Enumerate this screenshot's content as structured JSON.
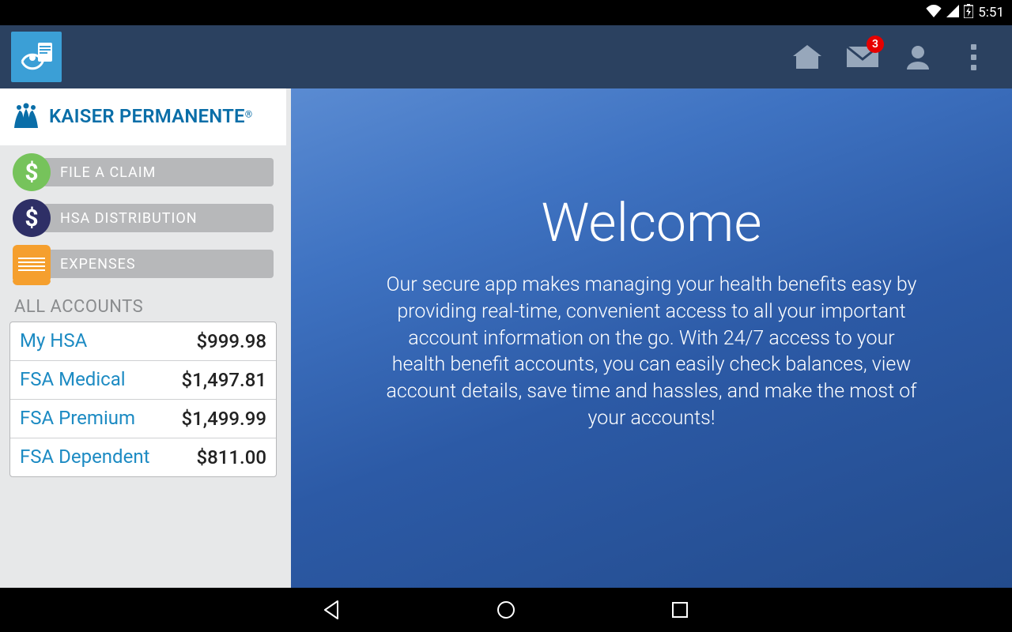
{
  "status": {
    "time": "5:51"
  },
  "appbar": {
    "badge": "3"
  },
  "brand": {
    "name": "KAISER PERMANENTE",
    "reg": "®"
  },
  "actions": {
    "file_claim": "FILE A CLAIM",
    "hsa_dist": "HSA DISTRIBUTION",
    "expenses": "EXPENSES"
  },
  "accounts": {
    "header": "ALL ACCOUNTS",
    "rows": [
      {
        "name": "My HSA",
        "value": "$999.98"
      },
      {
        "name": "FSA Medical",
        "value": "$1,497.81"
      },
      {
        "name": "FSA Premium",
        "value": "$1,499.99"
      },
      {
        "name": "FSA Dependent",
        "value": "$811.00"
      }
    ]
  },
  "main": {
    "title": "Welcome",
    "body": "Our secure app makes managing your health benefits easy by providing real-time, convenient access to all your important account information on the go. With 24/7 access to your health benefit accounts, you can easily check balances, view account details, save time and hassles, and make the most of your accounts!"
  }
}
